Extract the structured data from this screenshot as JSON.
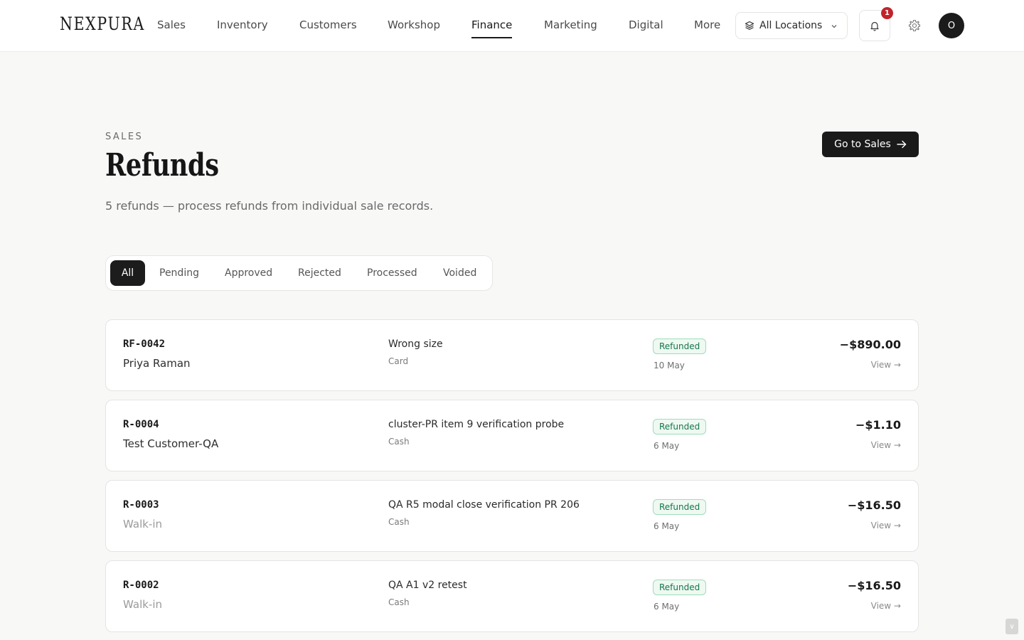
{
  "brand": {
    "name": "NEXPURA"
  },
  "nav": {
    "items": [
      {
        "label": "Sales",
        "active": false
      },
      {
        "label": "Inventory",
        "active": false
      },
      {
        "label": "Customers",
        "active": false
      },
      {
        "label": "Workshop",
        "active": false
      },
      {
        "label": "Finance",
        "active": true
      },
      {
        "label": "Marketing",
        "active": false
      },
      {
        "label": "Digital",
        "active": false
      },
      {
        "label": "More",
        "active": false
      }
    ]
  },
  "header": {
    "location_select": {
      "value": "All Locations",
      "icon": "layers-icon"
    },
    "notifications": {
      "count": "1",
      "icon": "bell-icon"
    },
    "settings": {
      "icon": "gear-icon"
    },
    "avatar": {
      "initial": "O"
    }
  },
  "page": {
    "eyebrow": "SALES",
    "title": "Refunds",
    "subtitle": "5 refunds — process refunds from individual sale records.",
    "action_button": {
      "label": "Go to Sales",
      "icon": "arrow-right-icon"
    }
  },
  "filters": {
    "tabs": [
      {
        "label": "All",
        "active": true
      },
      {
        "label": "Pending",
        "active": false
      },
      {
        "label": "Approved",
        "active": false
      },
      {
        "label": "Rejected",
        "active": false
      },
      {
        "label": "Processed",
        "active": false
      },
      {
        "label": "Voided",
        "active": false
      }
    ]
  },
  "refunds": [
    {
      "id": "RF-0042",
      "customer": "Priya Raman",
      "reason": "Wrong size",
      "method": "Card",
      "status": "Refunded",
      "date": "10 May",
      "amount": "−$890.00",
      "view": "View →"
    },
    {
      "id": "R-0004",
      "customer": "Test Customer-QA",
      "reason": "cluster-PR item 9 verification probe",
      "method": "Cash",
      "status": "Refunded",
      "date": "6 May",
      "amount": "−$1.10",
      "view": "View →"
    },
    {
      "id": "R-0003",
      "customer": "Walk-in",
      "reason": "QA R5 modal close verification PR 206",
      "method": "Cash",
      "status": "Refunded",
      "date": "6 May",
      "amount": "−$16.50",
      "view": "View →"
    },
    {
      "id": "R-0002",
      "customer": "Walk-in",
      "reason": "QA A1 v2 retest",
      "method": "Cash",
      "status": "Refunded",
      "date": "6 May",
      "amount": "−$16.50",
      "view": "View →"
    }
  ],
  "scroll_button": {
    "label": "∨"
  },
  "colors": {
    "accent": "#1a1a1a",
    "badge": "#c0242b",
    "status_green": "#17754a",
    "status_bg": "#eef9f2"
  }
}
